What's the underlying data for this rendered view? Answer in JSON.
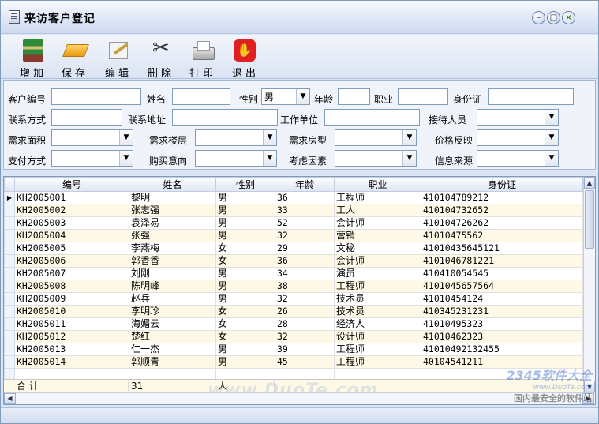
{
  "window": {
    "title": "来访客户登记",
    "buttons": {
      "minimize": "–",
      "maximize": "□",
      "close": "×"
    }
  },
  "toolbar": {
    "items": [
      {
        "label": "增加",
        "icon": "add-book-icon"
      },
      {
        "label": "保存",
        "icon": "save-icon"
      },
      {
        "label": "编辑",
        "icon": "edit-icon"
      },
      {
        "label": "删除",
        "icon": "scissors-icon"
      },
      {
        "label": "打印",
        "icon": "printer-icon"
      },
      {
        "label": "退出",
        "icon": "exit-hand-icon"
      }
    ]
  },
  "form": {
    "customer_id": {
      "label": "客户编号",
      "value": ""
    },
    "name": {
      "label": "姓名",
      "value": ""
    },
    "gender": {
      "label": "性别",
      "value": "男"
    },
    "age": {
      "label": "年龄",
      "value": ""
    },
    "occupation": {
      "label": "职业",
      "value": ""
    },
    "id_card": {
      "label": "身份证",
      "value": ""
    },
    "contact": {
      "label": "联系方式",
      "value": ""
    },
    "address": {
      "label": "联系地址",
      "value": ""
    },
    "employer": {
      "label": "工作单位",
      "value": ""
    },
    "receptionist": {
      "label": "接待人员",
      "value": ""
    },
    "area": {
      "label": "需求面积",
      "value": ""
    },
    "floor": {
      "label": "需求楼层",
      "value": ""
    },
    "room_type": {
      "label": "需求房型",
      "value": ""
    },
    "price_feedback": {
      "label": "价格反映",
      "value": ""
    },
    "payment": {
      "label": "支付方式",
      "value": ""
    },
    "intention": {
      "label": "购买意向",
      "value": ""
    },
    "factors": {
      "label": "考虑因素",
      "value": ""
    },
    "info_source": {
      "label": "信息来源",
      "value": ""
    }
  },
  "grid": {
    "columns": [
      "编号",
      "姓名",
      "性别",
      "年龄",
      "职业",
      "身份证"
    ],
    "rows": [
      [
        "KH2005001",
        "黎明",
        "男",
        "36",
        "工程师",
        "410104789212"
      ],
      [
        "KH2005002",
        "张志强",
        "男",
        "33",
        "工人",
        "410104732652"
      ],
      [
        "KH2005003",
        "袁泽易",
        "男",
        "52",
        "会计师",
        "410104726262"
      ],
      [
        "KH2005004",
        "张强",
        "男",
        "32",
        "营销",
        "41010475562"
      ],
      [
        "KH2005005",
        "李燕梅",
        "女",
        "29",
        "文秘",
        "41010435645121"
      ],
      [
        "KH2005006",
        "郭香香",
        "女",
        "36",
        "会计师",
        "410104678122​1"
      ],
      [
        "KH2005007",
        "刘刚",
        "男",
        "34",
        "演员",
        "410410054545"
      ],
      [
        "KH2005008",
        "陈明峰",
        "男",
        "38",
        "工程师",
        "41010456575​64"
      ],
      [
        "KH2005009",
        "赵兵",
        "男",
        "32",
        "技术员",
        "41010454124"
      ],
      [
        "KH2005010",
        "李明珍",
        "女",
        "26",
        "技术员",
        "410345231231"
      ],
      [
        "KH2005011",
        "海媚云",
        "女",
        "28",
        "经济人",
        "41010495323"
      ],
      [
        "KH2005012",
        "楚红",
        "女",
        "32",
        "设计师",
        "41010462323"
      ],
      [
        "KH2005013",
        "仁一杰",
        "男",
        "39",
        "工程师",
        "41010492132455"
      ],
      [
        "KH2005014",
        "郭顺青",
        "男",
        "45",
        "工程师",
        "40104541211"
      ]
    ],
    "total": {
      "label": "合 计",
      "count": "31",
      "unit": "人"
    },
    "row_indicator": "▶"
  },
  "watermarks": {
    "center": "www.DuoTe.com",
    "logo_main": "2345软件大全",
    "logo_url": "www.DuoTe.com",
    "logo_cn": "国内最安全的软件站"
  }
}
